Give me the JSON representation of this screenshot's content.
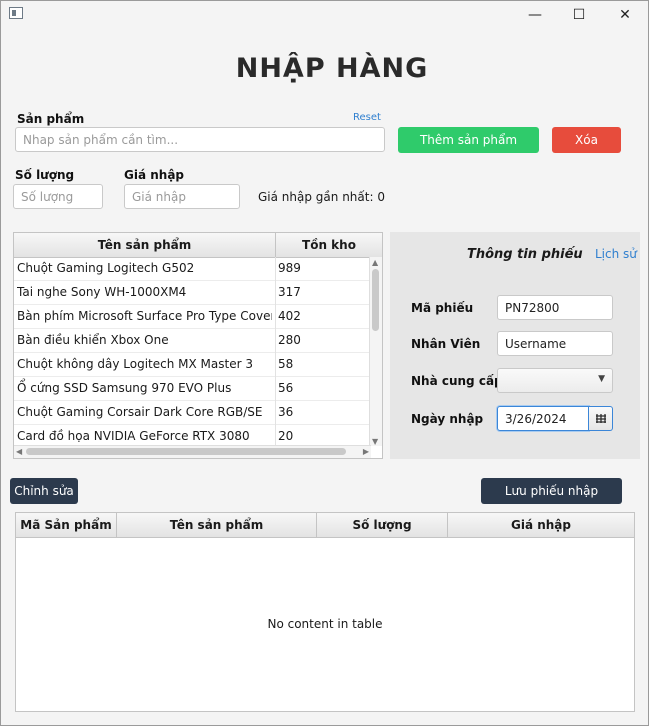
{
  "window": {
    "minimize_glyph": "—",
    "maximize_glyph": "☐",
    "close_glyph": "✕"
  },
  "page_title": "NHẬP HÀNG",
  "product": {
    "label": "Sản phẩm",
    "reset": "Reset",
    "search_placeholder": "Nhap sản phẩm cần tìm...",
    "add_button": "Thêm sản phẩm",
    "delete_button": "Xóa"
  },
  "quantity": {
    "label": "Số lượng",
    "placeholder": "Số lượng"
  },
  "price": {
    "label": "Giá nhập",
    "placeholder": "Giá nhập"
  },
  "latest_price": "Giá nhập gần nhất: 0",
  "products_table": {
    "columns": [
      "Tên sản phẩm",
      "Tồn kho"
    ],
    "rows": [
      [
        "Chuột Gaming Logitech G502",
        "989"
      ],
      [
        "Tai nghe Sony WH-1000XM4",
        "317"
      ],
      [
        "Bàn phím Microsoft Surface Pro Type Cover",
        "402"
      ],
      [
        "Bàn điều khiển Xbox One",
        "280"
      ],
      [
        "Chuột không dây Logitech MX Master 3",
        "58"
      ],
      [
        "Ổ cứng SSD Samsung 970 EVO Plus",
        "56"
      ],
      [
        "Chuột Gaming Corsair Dark Core RGB/SE",
        "36"
      ],
      [
        "Card đồ họa NVIDIA GeForce RTX 3080",
        "20"
      ]
    ]
  },
  "info": {
    "title": "Thông tin phiếu",
    "history": "Lịch sử",
    "code_label": "Mã phiếu",
    "code_value": "PN72800",
    "staff_label": "Nhân Viên",
    "staff_value": "Username",
    "supplier_label": "Nhà cung cấp",
    "supplier_value": "",
    "date_label": "Ngày nhập",
    "date_value": "3/26/2024"
  },
  "edit_button": "Chỉnh sửa",
  "save_button": "Lưu phiếu nhập",
  "receipt_table": {
    "columns": [
      "Mã Sản phẩm",
      "Tên sản phẩm",
      "Số lượng",
      "Giá nhập"
    ],
    "empty_text": "No content in table"
  }
}
